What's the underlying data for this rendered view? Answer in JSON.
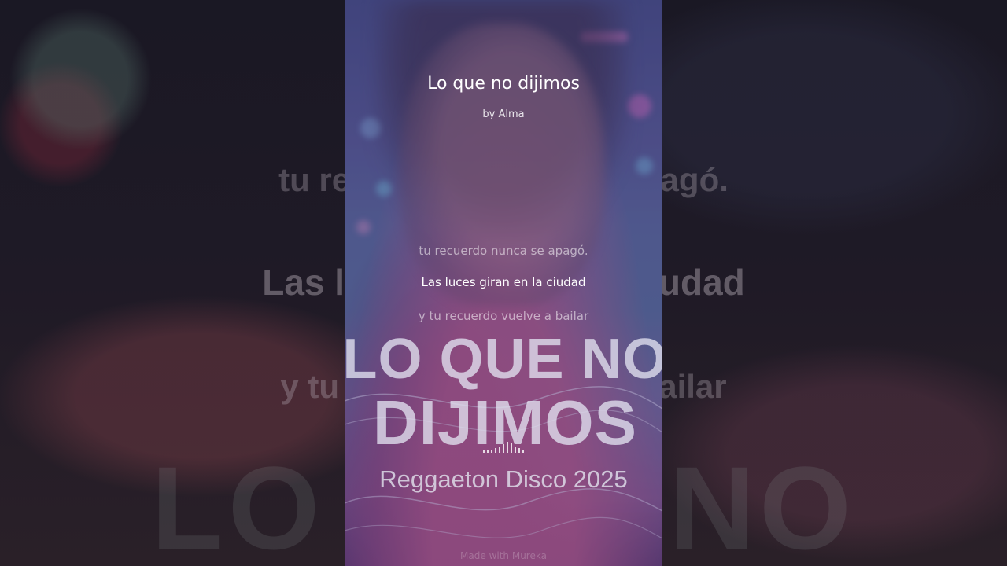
{
  "background": {
    "lyric_prev": "tu recuerdo nunca se apagó.",
    "lyric_current": "Las luces giran en la ciudad",
    "lyric_next": "y tu recuerdo vuelve a bailar",
    "big_title": "LO QUE NO"
  },
  "song": {
    "title": "Lo que no dijimos",
    "artist": "by Alma"
  },
  "lyrics": {
    "previous": "tu recuerdo nunca se apagó.",
    "current": "Las luces giran en la ciudad",
    "next": "y tu recuerdo vuelve a bailar"
  },
  "cover": {
    "title_line1": "LO QUE NO",
    "title_line2": "DIJIMOS",
    "subtitle": "Reggaeton Disco 2025"
  },
  "equalizer": {
    "bar_levels": [
      0.2,
      0.3,
      0.25,
      0.4,
      0.5,
      0.8,
      1.0,
      0.9,
      0.6,
      0.4,
      0.3
    ]
  },
  "watermark": "Made with Mureka",
  "colors": {
    "panel_top": "#4a4f92",
    "panel_bottom": "#6a3f80",
    "accent_pink": "#be5a96"
  }
}
